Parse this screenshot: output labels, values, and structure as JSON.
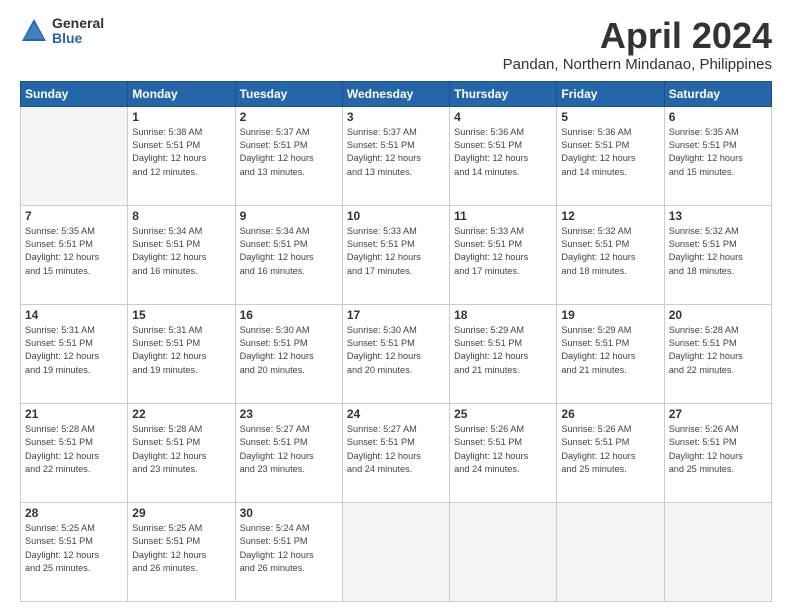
{
  "logo": {
    "general": "General",
    "blue": "Blue"
  },
  "title": "April 2024",
  "subtitle": "Pandan, Northern Mindanao, Philippines",
  "headers": [
    "Sunday",
    "Monday",
    "Tuesday",
    "Wednesday",
    "Thursday",
    "Friday",
    "Saturday"
  ],
  "weeks": [
    [
      {
        "day": "",
        "info": ""
      },
      {
        "day": "1",
        "info": "Sunrise: 5:38 AM\nSunset: 5:51 PM\nDaylight: 12 hours\nand 12 minutes."
      },
      {
        "day": "2",
        "info": "Sunrise: 5:37 AM\nSunset: 5:51 PM\nDaylight: 12 hours\nand 13 minutes."
      },
      {
        "day": "3",
        "info": "Sunrise: 5:37 AM\nSunset: 5:51 PM\nDaylight: 12 hours\nand 13 minutes."
      },
      {
        "day": "4",
        "info": "Sunrise: 5:36 AM\nSunset: 5:51 PM\nDaylight: 12 hours\nand 14 minutes."
      },
      {
        "day": "5",
        "info": "Sunrise: 5:36 AM\nSunset: 5:51 PM\nDaylight: 12 hours\nand 14 minutes."
      },
      {
        "day": "6",
        "info": "Sunrise: 5:35 AM\nSunset: 5:51 PM\nDaylight: 12 hours\nand 15 minutes."
      }
    ],
    [
      {
        "day": "7",
        "info": "Sunrise: 5:35 AM\nSunset: 5:51 PM\nDaylight: 12 hours\nand 15 minutes."
      },
      {
        "day": "8",
        "info": "Sunrise: 5:34 AM\nSunset: 5:51 PM\nDaylight: 12 hours\nand 16 minutes."
      },
      {
        "day": "9",
        "info": "Sunrise: 5:34 AM\nSunset: 5:51 PM\nDaylight: 12 hours\nand 16 minutes."
      },
      {
        "day": "10",
        "info": "Sunrise: 5:33 AM\nSunset: 5:51 PM\nDaylight: 12 hours\nand 17 minutes."
      },
      {
        "day": "11",
        "info": "Sunrise: 5:33 AM\nSunset: 5:51 PM\nDaylight: 12 hours\nand 17 minutes."
      },
      {
        "day": "12",
        "info": "Sunrise: 5:32 AM\nSunset: 5:51 PM\nDaylight: 12 hours\nand 18 minutes."
      },
      {
        "day": "13",
        "info": "Sunrise: 5:32 AM\nSunset: 5:51 PM\nDaylight: 12 hours\nand 18 minutes."
      }
    ],
    [
      {
        "day": "14",
        "info": "Sunrise: 5:31 AM\nSunset: 5:51 PM\nDaylight: 12 hours\nand 19 minutes."
      },
      {
        "day": "15",
        "info": "Sunrise: 5:31 AM\nSunset: 5:51 PM\nDaylight: 12 hours\nand 19 minutes."
      },
      {
        "day": "16",
        "info": "Sunrise: 5:30 AM\nSunset: 5:51 PM\nDaylight: 12 hours\nand 20 minutes."
      },
      {
        "day": "17",
        "info": "Sunrise: 5:30 AM\nSunset: 5:51 PM\nDaylight: 12 hours\nand 20 minutes."
      },
      {
        "day": "18",
        "info": "Sunrise: 5:29 AM\nSunset: 5:51 PM\nDaylight: 12 hours\nand 21 minutes."
      },
      {
        "day": "19",
        "info": "Sunrise: 5:29 AM\nSunset: 5:51 PM\nDaylight: 12 hours\nand 21 minutes."
      },
      {
        "day": "20",
        "info": "Sunrise: 5:28 AM\nSunset: 5:51 PM\nDaylight: 12 hours\nand 22 minutes."
      }
    ],
    [
      {
        "day": "21",
        "info": "Sunrise: 5:28 AM\nSunset: 5:51 PM\nDaylight: 12 hours\nand 22 minutes."
      },
      {
        "day": "22",
        "info": "Sunrise: 5:28 AM\nSunset: 5:51 PM\nDaylight: 12 hours\nand 23 minutes."
      },
      {
        "day": "23",
        "info": "Sunrise: 5:27 AM\nSunset: 5:51 PM\nDaylight: 12 hours\nand 23 minutes."
      },
      {
        "day": "24",
        "info": "Sunrise: 5:27 AM\nSunset: 5:51 PM\nDaylight: 12 hours\nand 24 minutes."
      },
      {
        "day": "25",
        "info": "Sunrise: 5:26 AM\nSunset: 5:51 PM\nDaylight: 12 hours\nand 24 minutes."
      },
      {
        "day": "26",
        "info": "Sunrise: 5:26 AM\nSunset: 5:51 PM\nDaylight: 12 hours\nand 25 minutes."
      },
      {
        "day": "27",
        "info": "Sunrise: 5:26 AM\nSunset: 5:51 PM\nDaylight: 12 hours\nand 25 minutes."
      }
    ],
    [
      {
        "day": "28",
        "info": "Sunrise: 5:25 AM\nSunset: 5:51 PM\nDaylight: 12 hours\nand 25 minutes."
      },
      {
        "day": "29",
        "info": "Sunrise: 5:25 AM\nSunset: 5:51 PM\nDaylight: 12 hours\nand 26 minutes."
      },
      {
        "day": "30",
        "info": "Sunrise: 5:24 AM\nSunset: 5:51 PM\nDaylight: 12 hours\nand 26 minutes."
      },
      {
        "day": "",
        "info": ""
      },
      {
        "day": "",
        "info": ""
      },
      {
        "day": "",
        "info": ""
      },
      {
        "day": "",
        "info": ""
      }
    ]
  ]
}
